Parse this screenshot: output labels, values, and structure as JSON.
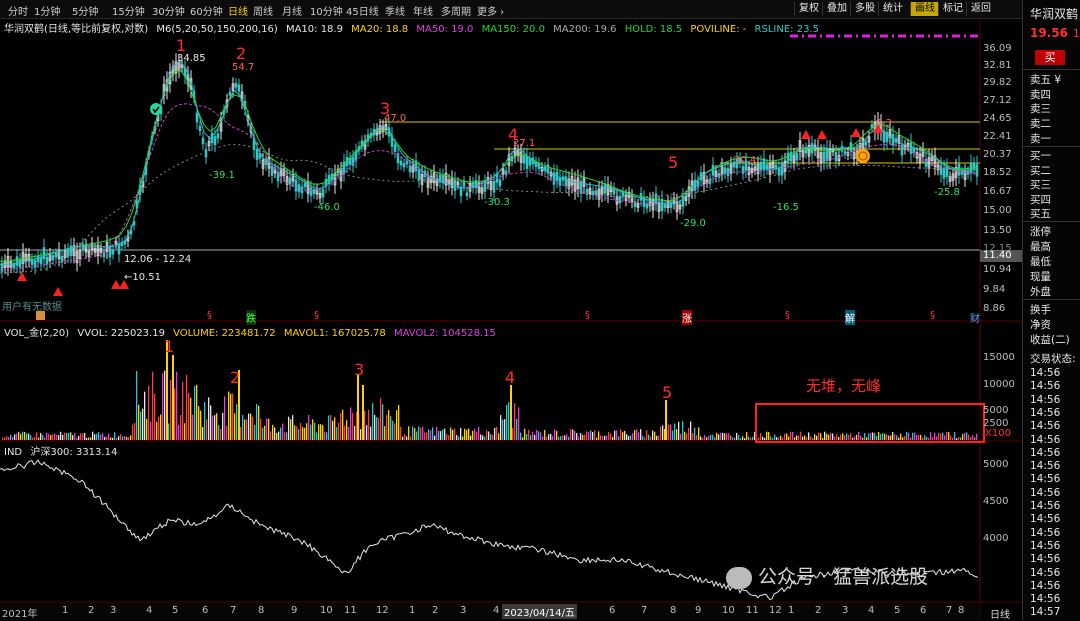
{
  "periods": [
    "分时",
    "1分钟",
    "5分钟",
    "15分钟",
    "30分钟",
    "60分钟",
    "日线",
    "周线",
    "月线",
    "10分钟",
    "45日线",
    "季线",
    "年线",
    "多周期",
    "更多 ›"
  ],
  "active_period": "日线",
  "toolbar_right": [
    "复权",
    "叠加",
    "多股",
    "统计",
    "画线",
    "标记",
    "返回"
  ],
  "price_header": {
    "title": "华润双鹤(日线,等比前复权,对数)",
    "ma_set": "M6(5,20,50,150,200,16)",
    "ma10": "MA10: 18.9",
    "ma20": "MA20: 18.8",
    "ma50": "MA50: 19.0",
    "ma150": "MA150: 20.0",
    "ma200": "MA200: 19.6",
    "hold": "HOLD: 18.5",
    "poviline": "POVILINE: -",
    "rsline": "RSLINE: 23.5"
  },
  "price_axis": [
    "36.09",
    "32.81",
    "29.82",
    "27.12",
    "24.65",
    "22.41",
    "20.37",
    "18.52",
    "16.67",
    "15.00",
    "13.50",
    "12.15",
    "10.94",
    "9.84",
    "8.86"
  ],
  "current_price_tag": "11.40",
  "price_labels": {
    "p1_high": "34.85",
    "p2_high": "54.7",
    "p3": "47.0",
    "p4": "27.1",
    "p5": "30.4",
    "p6": "6.3",
    "low1": "-39.1",
    "low2": "-46.0",
    "low3": "-30.3",
    "low4": "-29.0",
    "low5": "-16.5",
    "low6": "-25.8",
    "range_text": "12.06 - 12.24",
    "low_price": "←10.51"
  },
  "wave_numbers": [
    "1",
    "2",
    "3",
    "4",
    "5"
  ],
  "event_markers": [
    "跌",
    "§",
    "涨",
    "解",
    "财"
  ],
  "no_data_text": "用户有无数据",
  "vol_header": {
    "title": "VOL_金(2,20)",
    "vvol": "VVOL: 225023.19",
    "volume": "VOLUME: 223481.72",
    "mavol1": "MAVOL1: 167025.78",
    "mavol2": "MAVOL2: 104528.15"
  },
  "vol_axis": [
    "15000",
    "10000",
    "5000",
    "2500"
  ],
  "vol_unit": "X100",
  "vol_annotation": "无堆，无峰",
  "ind_header": {
    "title": "IND",
    "name": "沪深300: 3313.14"
  },
  "ind_axis": [
    "5000",
    "4500",
    "4000"
  ],
  "x_axis": {
    "labels": [
      "2021年",
      "1",
      "2",
      "3",
      "4",
      "5",
      "6",
      "7",
      "8",
      "9",
      "10",
      "11",
      "12",
      "1",
      "2",
      "3",
      "4",
      "2023/04/14/五",
      "6",
      "7",
      "8",
      "9",
      "10",
      "11",
      "12",
      "1",
      "2",
      "3",
      "4",
      "5",
      "6",
      "7",
      "8"
    ],
    "period_label": "日线"
  },
  "side": {
    "stock_name": "华润双鹤",
    "price": "19.56",
    "price_extra": "1.",
    "buy_button": "买",
    "asks": [
      "卖五 ¥",
      "卖四",
      "卖三",
      "卖二",
      "卖一"
    ],
    "bids": [
      "买一",
      "买二",
      "买三",
      "买四",
      "买五"
    ],
    "stats": [
      "涨停",
      "最高",
      "最低",
      "现量",
      "外盘"
    ],
    "stats2": [
      "换手",
      "净资",
      "收益(二)"
    ],
    "trade_state": "交易状态:",
    "ticks": [
      "14:56",
      "14:56",
      "14:56",
      "14:56",
      "14:56",
      "14:56",
      "14:56",
      "14:56",
      "14:56",
      "14:56",
      "14:56",
      "14:56",
      "14:56",
      "14:56",
      "14:56",
      "14:56",
      "14:56",
      "14:56",
      "14:57"
    ]
  },
  "watermark": "公众号 · 猛兽派选股",
  "colors": {
    "up": "#ff3030",
    "down": "#30c8c8",
    "accent": "#ffd200",
    "ma": "#e040e0",
    "green": "#28d828"
  }
}
